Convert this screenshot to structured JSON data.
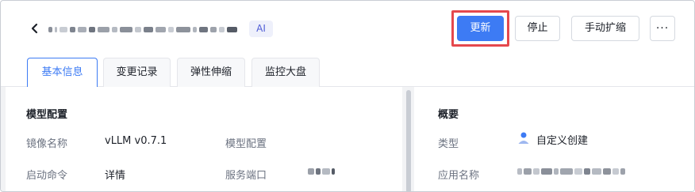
{
  "header": {
    "back_icon": "chevron-left-icon",
    "ai_badge": "AI",
    "buttons": {
      "update": "更新",
      "stop": "停止",
      "manual_scale": "手动扩缩",
      "more": "···"
    }
  },
  "tabs": [
    {
      "label": "基本信息",
      "active": true
    },
    {
      "label": "变更记录",
      "active": false
    },
    {
      "label": "弹性伸缩",
      "active": false
    },
    {
      "label": "监控大盘",
      "active": false
    }
  ],
  "model_config": {
    "title": "模型配置",
    "image_name_label": "镜像名称",
    "image_name_value": "vLLM v0.7.1",
    "model_config_label": "模型配置",
    "start_command_label": "启动命令",
    "start_command_value": "详情",
    "service_port_label": "服务端口"
  },
  "overview": {
    "title": "概要",
    "type_label": "类型",
    "type_value": "自定义创建",
    "type_icon": "custom-create-icon",
    "app_name_label": "应用名称"
  },
  "colors": {
    "primary": "#3d7bf4",
    "highlight": "#e5484d",
    "ai_badge_bg": "#eef0fb",
    "ai_badge_text": "#4e5bd6"
  }
}
